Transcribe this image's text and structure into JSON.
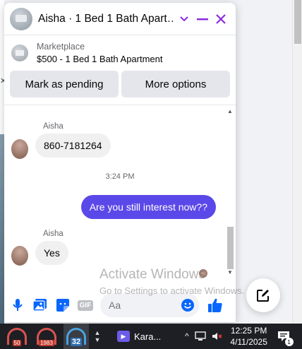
{
  "chat": {
    "title": "Aisha · 1 Bed 1 Bath Apart…",
    "listing": {
      "source": "Marketplace",
      "name": "$500 - 1 Bed 1 Bath Apartment"
    },
    "actions": {
      "mark_pending": "Mark as pending",
      "more_options": "More options"
    },
    "messages": [
      {
        "sender": "Aisha",
        "text": "860-7181264"
      },
      {
        "timestamp": "3:24 PM"
      },
      {
        "outgoing_text": "Are you still interest now??"
      },
      {
        "sender": "Aisha",
        "text": "Yes"
      }
    ],
    "composer": {
      "placeholder": "Aa",
      "gif_label": "GIF"
    }
  },
  "watermark": {
    "title": "Activate Windows",
    "subtitle": "Go to Settings to activate Windows."
  },
  "taskbar": {
    "gauges": [
      "50",
      "1983",
      "32"
    ],
    "app_label": "Kara...",
    "time": "12:25 PM",
    "date": "4/11/2025",
    "notification_count": "1"
  },
  "colors": {
    "accent": "#8a2be2",
    "outgoing_bubble": "#5b48e8",
    "messenger_blue": "#0866ff"
  }
}
